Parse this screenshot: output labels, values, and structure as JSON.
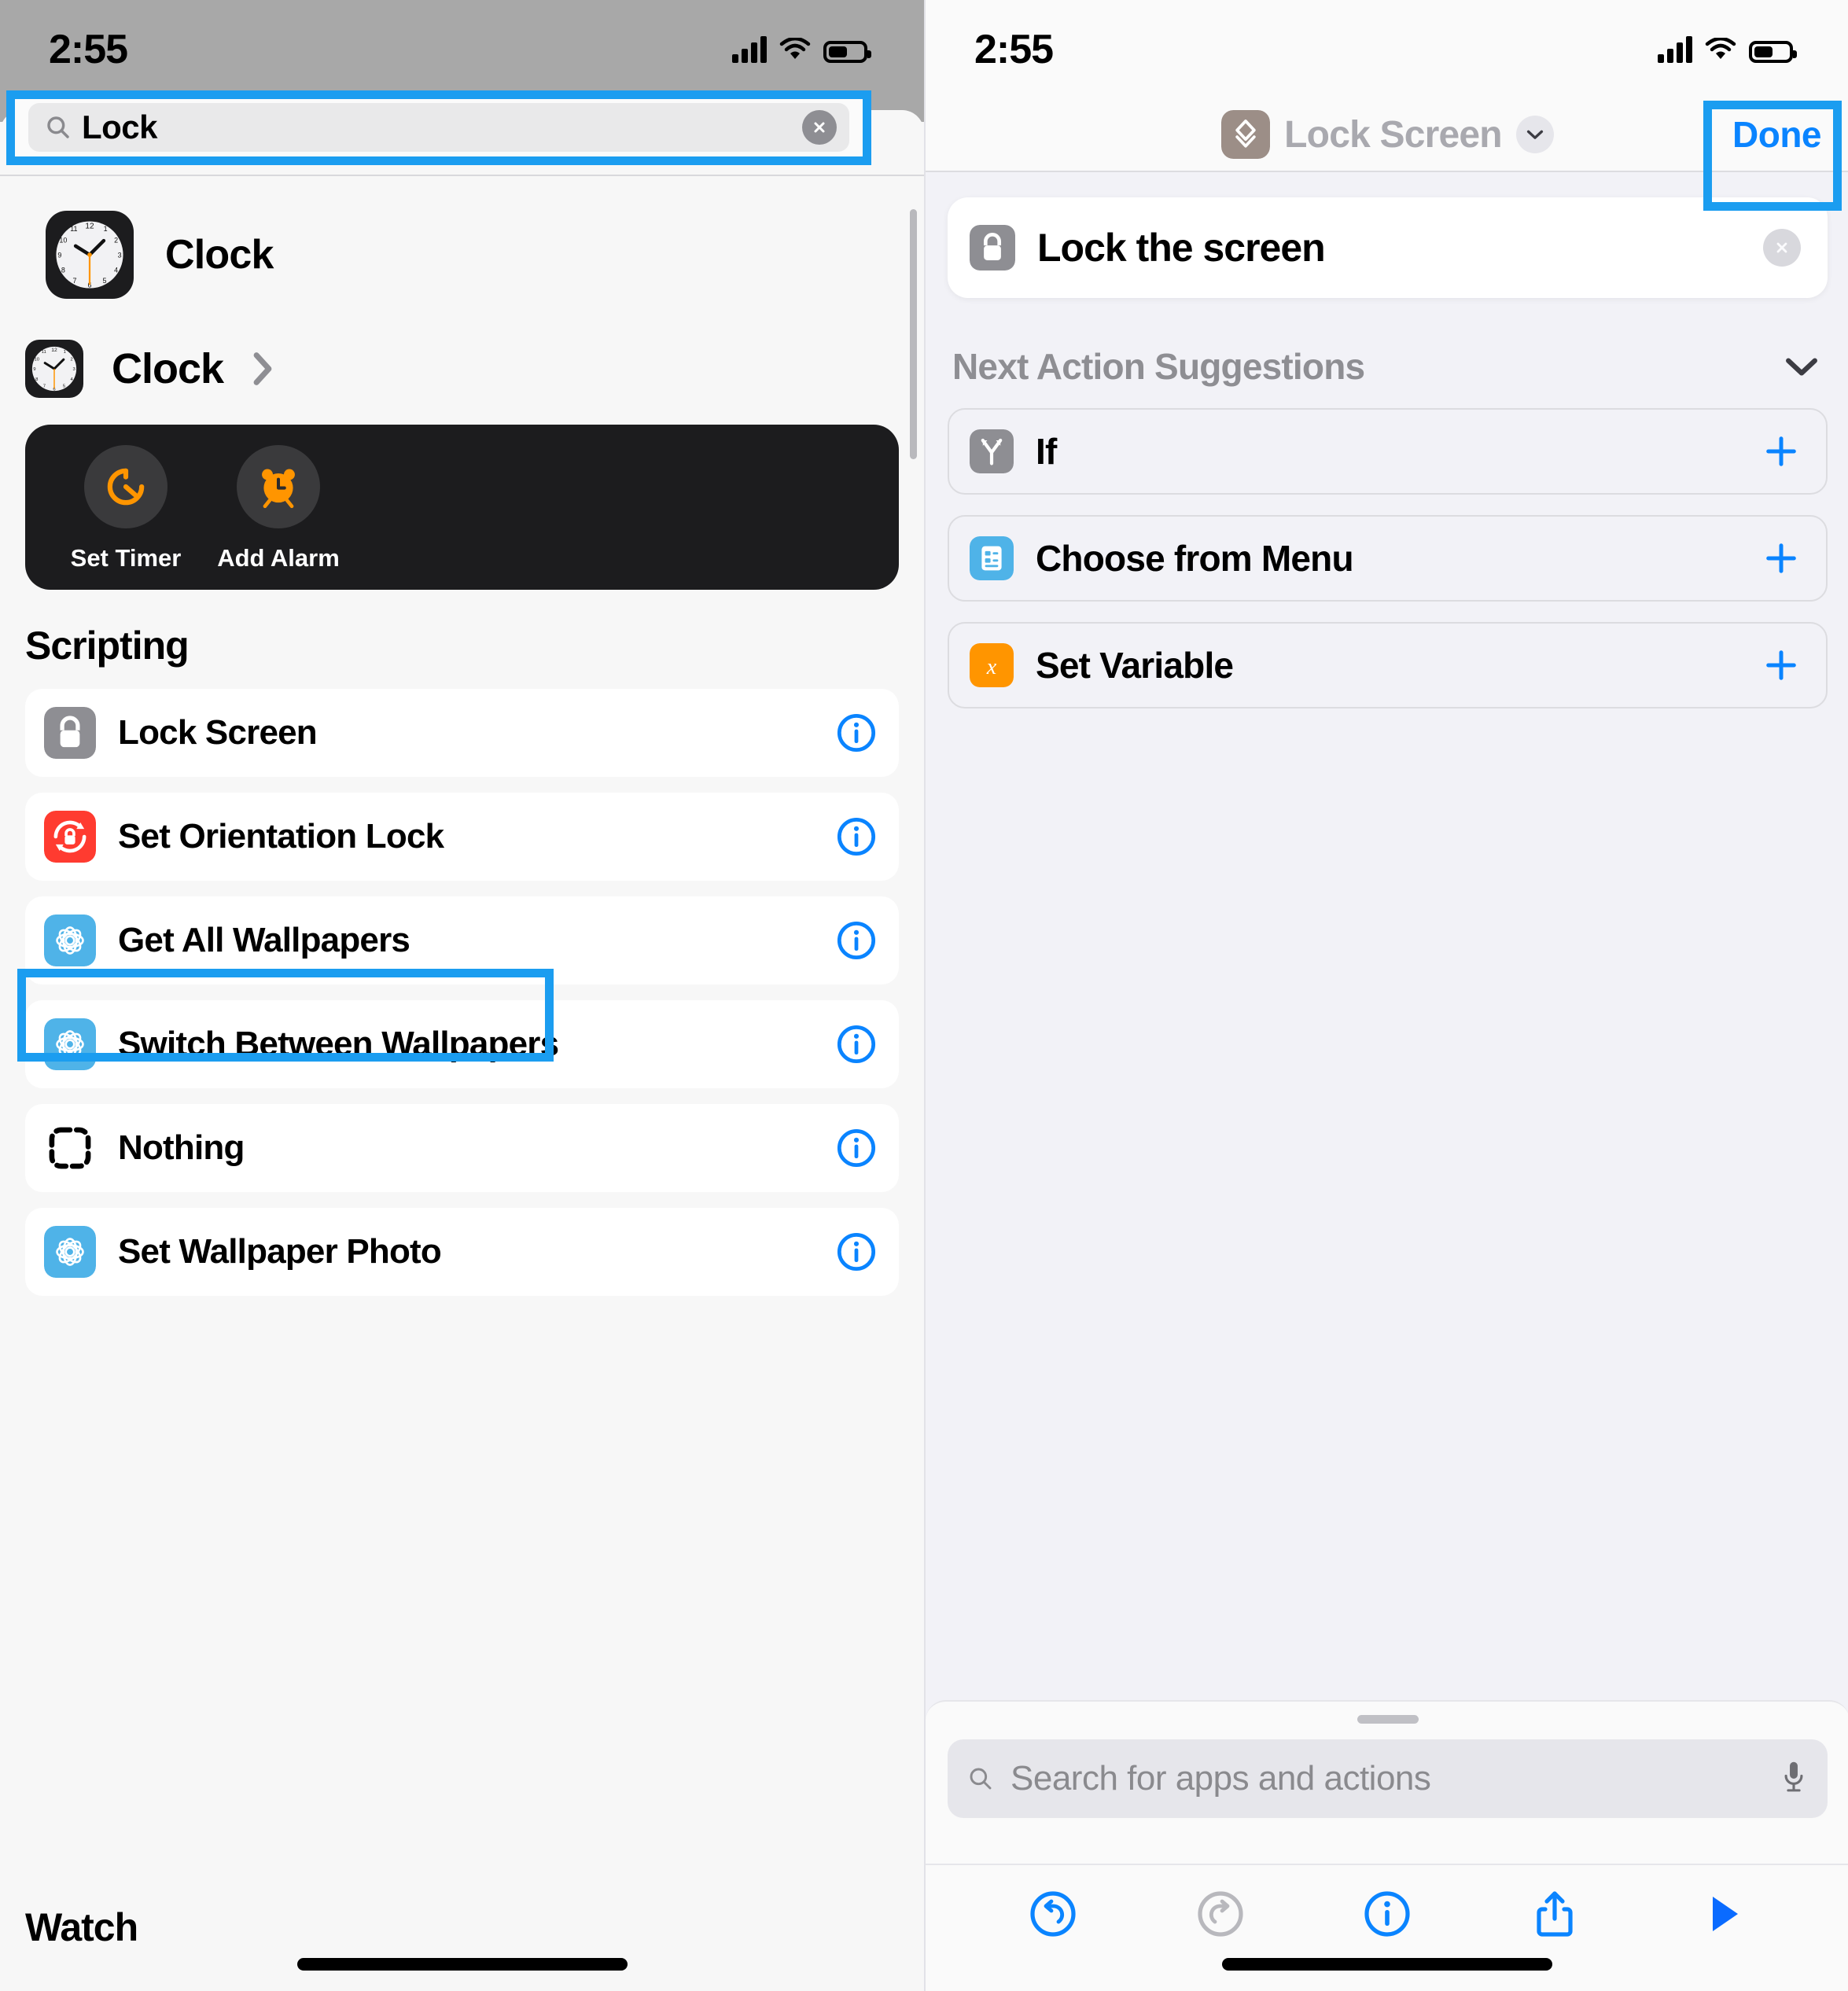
{
  "left": {
    "status": {
      "time": "2:55",
      "signal_icon": "cellular-bars-icon",
      "wifi_icon": "wifi-icon",
      "battery_icon": "battery-icon"
    },
    "search": {
      "value": "Lock",
      "search_icon": "search-icon",
      "clear_icon": "clear-circle-icon",
      "highlight_color": "#1b9df0"
    },
    "app_result": {
      "label": "Clock",
      "icon": "clock-app-icon"
    },
    "app_header": {
      "label": "Clock",
      "icon": "clock-app-icon",
      "chevron_icon": "chevron-right-icon"
    },
    "quick_actions": [
      {
        "label": "Set Timer",
        "icon": "timer-icon",
        "accent": "#FF9500"
      },
      {
        "label": "Add Alarm",
        "icon": "alarm-clock-icon",
        "accent": "#FF9500"
      }
    ],
    "sections": [
      {
        "title": "Scripting",
        "rows": [
          {
            "label": "Lock Screen",
            "icon": "lock-icon",
            "icon_color": "#8e8e93",
            "info_icon": "info-circle-icon",
            "highlighted": true
          },
          {
            "label": "Set Orientation Lock",
            "icon": "orientation-lock-icon",
            "icon_color": "#FF3B30",
            "info_icon": "info-circle-icon",
            "highlighted": false
          },
          {
            "label": "Get All Wallpapers",
            "icon": "wallpaper-flower-icon",
            "icon_color": "#4FB3E8",
            "info_icon": "info-circle-icon",
            "highlighted": false
          },
          {
            "label": "Switch Between Wallpapers",
            "icon": "wallpaper-flower-icon",
            "icon_color": "#4FB3E8",
            "info_icon": "info-circle-icon",
            "highlighted": false
          },
          {
            "label": "Nothing",
            "icon": "dashed-square-icon",
            "icon_color": "#000000",
            "info_icon": "info-circle-icon",
            "highlighted": false
          },
          {
            "label": "Set Wallpaper Photo",
            "icon": "wallpaper-flower-icon",
            "icon_color": "#4FB3E8",
            "info_icon": "info-circle-icon",
            "highlighted": false
          }
        ]
      }
    ],
    "footer_section_title": "Watch"
  },
  "right": {
    "status": {
      "time": "2:55",
      "signal_icon": "cellular-bars-icon",
      "wifi_icon": "wifi-icon",
      "battery_icon": "battery-icon"
    },
    "navbar": {
      "shortcut_icon": "shortcut-stack-icon",
      "shortcut_icon_color": "#9C8E87",
      "title": "Lock Screen",
      "chevron_icon": "chevron-down-icon",
      "done_label": "Done",
      "done_color": "#0a84ff",
      "highlight_color": "#1b9df0"
    },
    "action": {
      "label": "Lock the screen",
      "icon": "lock-icon",
      "icon_color": "#8e8e93",
      "remove_icon": "close-circle-icon"
    },
    "suggestions_header": {
      "title": "Next Action Suggestions",
      "chevron_icon": "chevron-down-icon"
    },
    "suggestions": [
      {
        "label": "If",
        "icon": "branch-icon",
        "icon_color": "#8e8e93",
        "add_icon": "plus-icon"
      },
      {
        "label": "Choose from Menu",
        "icon": "menu-list-icon",
        "icon_color": "#4FB3E8",
        "add_icon": "plus-icon"
      },
      {
        "label": "Set Variable",
        "icon": "variable-x-icon",
        "icon_color": "#FF9500",
        "add_icon": "plus-icon"
      }
    ],
    "bottom_search": {
      "placeholder": "Search for apps and actions",
      "search_icon": "search-icon",
      "mic_icon": "microphone-icon"
    },
    "toolbar": [
      {
        "name": "undo-button",
        "icon": "undo-icon",
        "enabled": true
      },
      {
        "name": "redo-button",
        "icon": "redo-icon",
        "enabled": false
      },
      {
        "name": "info-button",
        "icon": "info-circle-icon",
        "enabled": true
      },
      {
        "name": "share-button",
        "icon": "share-icon",
        "enabled": true
      },
      {
        "name": "run-button",
        "icon": "play-icon",
        "enabled": true
      }
    ]
  }
}
